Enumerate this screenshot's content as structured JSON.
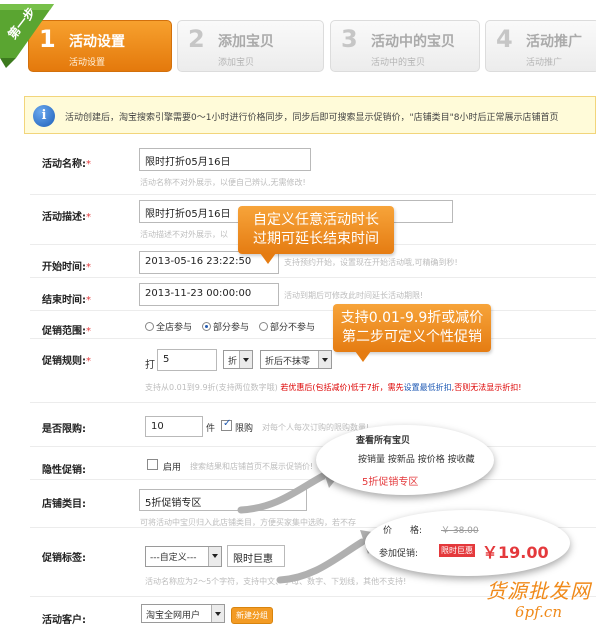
{
  "ribbon": {
    "text": "第一步"
  },
  "steps": [
    {
      "num": "1",
      "title": "活动设置",
      "sub": "活动设置"
    },
    {
      "num": "2",
      "title": "添加宝贝",
      "sub": "添加宝贝"
    },
    {
      "num": "3",
      "title": "活动中的宝贝",
      "sub": "活动中的宝贝"
    },
    {
      "num": "4",
      "title": "活动推广",
      "sub": "活动推广"
    }
  ],
  "notice": {
    "icon": "i",
    "text": "活动创建后，淘宝搜索引擎需要0～1小时进行价格同步，同步后即可搜索显示促销价，\"店铺类目\"8小时后正常展示店铺首页"
  },
  "form": {
    "name": {
      "label": "活动名称:",
      "req": "*",
      "value": "限时打折05月16日",
      "hint": "活动名称不对外展示，以便自己辨认,无需修改!"
    },
    "desc": {
      "label": "活动描述:",
      "req": "*",
      "value": "限时打折05月16日",
      "hint": "活动描述不对外展示，以"
    },
    "start": {
      "label": "开始时间:",
      "req": "*",
      "value": "2013-05-16 23:22:50",
      "hint": "支持预约开始，设置现在开始活动哦,可精确到秒!"
    },
    "end": {
      "label": "结束时间:",
      "req": "*",
      "value": "2013-11-23 00:00:00",
      "hint": "活动到期后可修改此时间延长活动期限!"
    },
    "scope": {
      "label": "促销范围:",
      "req": "*",
      "options": [
        "全店参与",
        "部分参与",
        "部分不参与"
      ],
      "selected": "部分参与"
    },
    "rule": {
      "label": "促销规则:",
      "req": "*",
      "prefix": "打",
      "value": "5",
      "unit": "折",
      "round": "折后不抹零",
      "hint1": "支持从0.01到9.9折(支持两位数字哦)",
      "hint2": "若优惠后(包括减价)低于7折，需先",
      "hint3": "设置最低折扣",
      "hint4": ",否则无法显示折扣!"
    },
    "limit": {
      "label": "是否限购:",
      "value": "10",
      "unit": "件",
      "check_label": "限购",
      "hint": "对每个人每次订购的限购数量!"
    },
    "hidden": {
      "label": "隐性促销:",
      "check_label": "启用",
      "hint": "搜索结果和店铺首页不展示促销价!"
    },
    "category": {
      "label": "店铺类目:",
      "value": "5折促销专区",
      "hint": "可将活动中宝贝归入此店铺类目，方便买家集中选购，若不存"
    },
    "tag": {
      "label": "促销标签:",
      "select": "---自定义---",
      "value": "限时巨惠",
      "hint": "活动名称应为2～5个字符，支持中文、字母、数字、下划线，其他不支持!"
    },
    "customer": {
      "label": "活动客户:",
      "select": "淘宝全网用户",
      "button": "新建分组"
    }
  },
  "callouts": {
    "time": [
      "自定义任意活动时长",
      "过期可延长结束时间"
    ],
    "discount": [
      "支持0.01-9.9折或减价",
      "第二步可定义个性促销"
    ]
  },
  "popup_category": {
    "title": "查看所有宝贝",
    "tabs": [
      "按销量",
      "按新品",
      "按价格",
      "按收藏"
    ],
    "item": "5折促销专区"
  },
  "popup_price": {
    "price_label": "价　　格:",
    "old_price": "￥ 38.00",
    "promo_label": "参加促销:",
    "tag": "限时巨惠",
    "new_price": "￥19.00"
  },
  "watermark": {
    "line1": "货源批发网",
    "line2": "6pf.cn"
  },
  "colors": {
    "accent": "#e98218",
    "price_red": "#e4393c"
  }
}
